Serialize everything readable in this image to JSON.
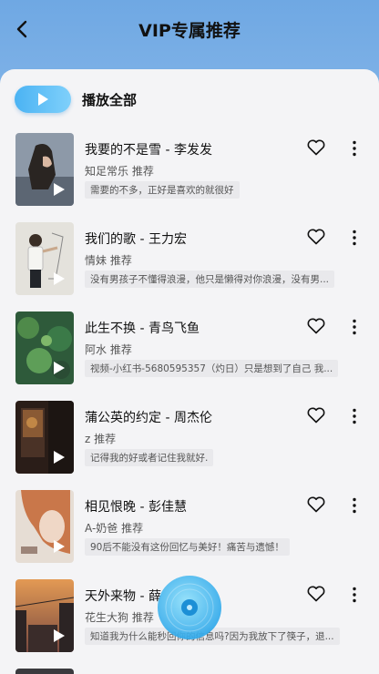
{
  "header": {
    "title": "VIP专属推荐"
  },
  "play_all": {
    "label": "播放全部"
  },
  "songs": [
    {
      "title": "我要的不是雪 - 李发发",
      "recommender": "知足常乐 推荐",
      "comment": "需要的不多，正好是喜欢的就很好"
    },
    {
      "title": "我们的歌 - 王力宏",
      "recommender": "情妹 推荐",
      "comment": "没有男孩子不懂得浪漫，他只是懒得对你浪漫，没有男..."
    },
    {
      "title": "此生不换 - 青鸟飞鱼",
      "recommender": "阿水 推荐",
      "comment": "视频-小红书-5680595357（灼日）只是想到了自己 我..."
    },
    {
      "title": "蒲公英的约定 - 周杰伦",
      "recommender": "z 推荐",
      "comment": "记得我的好或者记住我就好."
    },
    {
      "title": "相见恨晚 - 彭佳慧",
      "recommender": "A-奶爸 推荐",
      "comment": "90后不能没有这份回忆与美好！痛苦与遗憾！"
    },
    {
      "title": "天外来物 - 薛",
      "recommender": "花生大狗 推荐",
      "comment": "知道我为什么能秒回你的信息吗?因为我放下了筷子，退..."
    }
  ],
  "colors": {
    "accent": "#4bb3f3",
    "background": "#f4f4f6"
  }
}
